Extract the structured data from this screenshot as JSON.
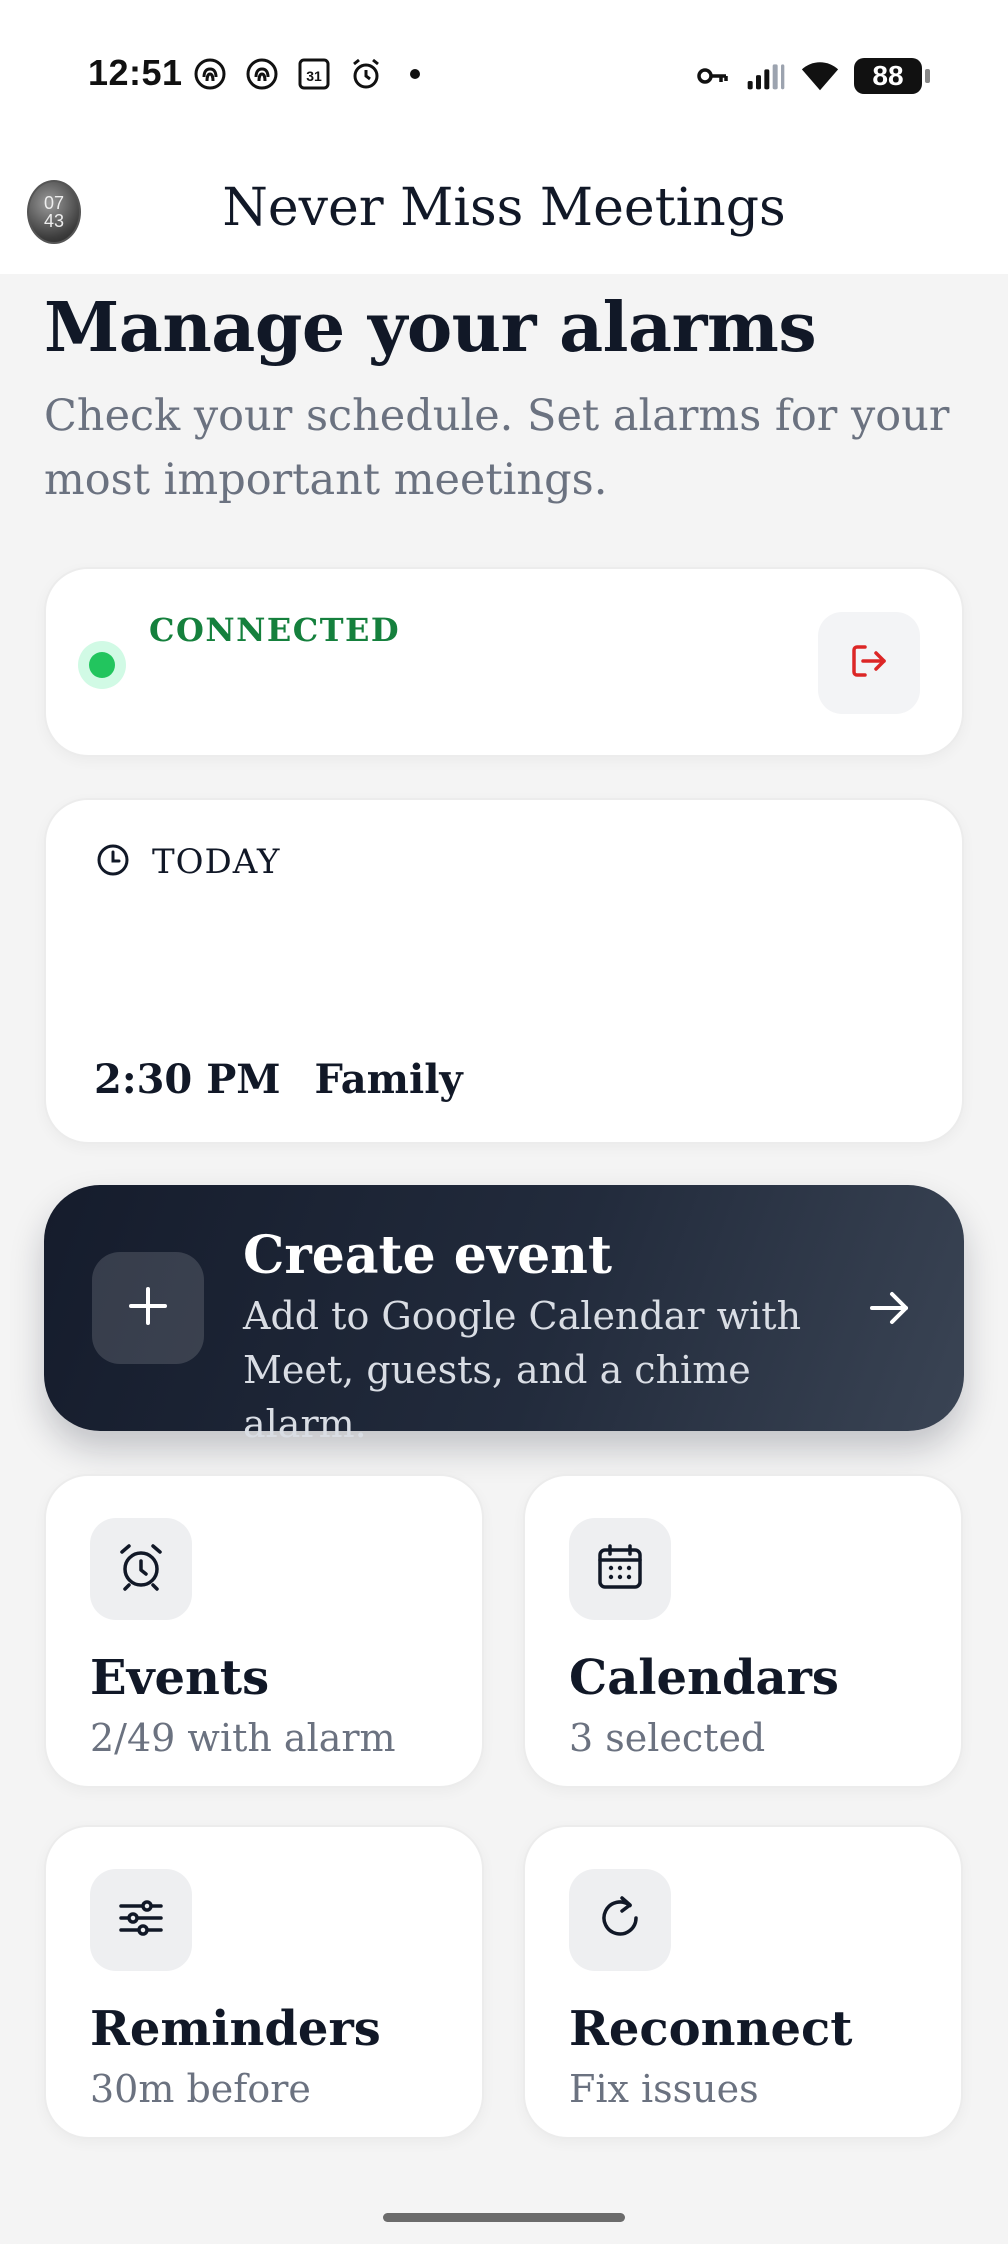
{
  "status_bar": {
    "time": "12:51",
    "left_icons": [
      "fingerprint-icon",
      "fingerprint-icon",
      "calendar-31-icon",
      "alarm-clock-icon",
      "dot-icon"
    ],
    "calendar_day": "31",
    "right_icons": [
      "key-icon",
      "signal-icon",
      "wifi-icon"
    ],
    "battery": "88"
  },
  "app_bar": {
    "title": "Never Miss Meetings",
    "avatar_line1": "07",
    "avatar_line2": "43"
  },
  "header": {
    "title": "Manage your alarms",
    "subtitle": "Check your schedule. Set alarms for your most important meetings."
  },
  "connection": {
    "status": "CONNECTED",
    "status_color": "#15803d",
    "logout_icon": "logout-icon",
    "logout_color": "#dc2626"
  },
  "today": {
    "label": "TODAY",
    "icon": "clock-icon",
    "event_time": "2:30 PM",
    "event_title": "Family"
  },
  "create_event": {
    "title": "Create event",
    "description": "Add to Google Calendar with Meet, guests, and a chime alarm.",
    "icon": "plus-icon",
    "arrow_icon": "arrow-right-icon"
  },
  "tiles": [
    {
      "icon": "alarm-clock-icon",
      "title": "Events",
      "subtitle": "2/49 with alarm"
    },
    {
      "icon": "calendar-icon",
      "title": "Calendars",
      "subtitle": "3 selected"
    },
    {
      "icon": "sliders-icon",
      "title": "Reminders",
      "subtitle": "30m before"
    },
    {
      "icon": "refresh-icon",
      "title": "Reconnect",
      "subtitle": "Fix issues"
    }
  ],
  "colors": {
    "accent_dark": "#151c2c",
    "connected_dot": "#22c55e",
    "muted_text": "#6b7280"
  }
}
